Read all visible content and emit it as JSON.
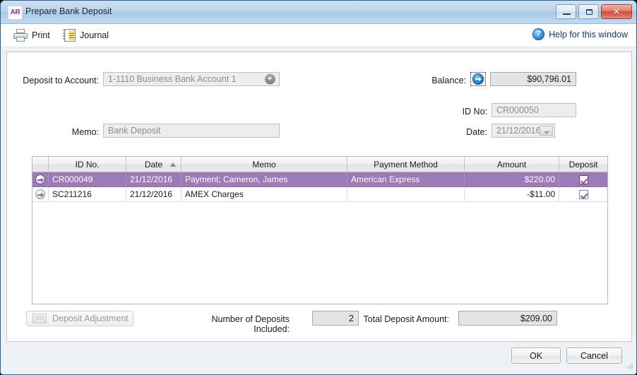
{
  "window": {
    "title": "Prepare Bank Deposit",
    "app_icon_text": "AR",
    "minimize_label": "Minimize",
    "maximize_label": "Maximize",
    "close_label": "✕"
  },
  "toolbar": {
    "print_label": "Print",
    "journal_label": "Journal",
    "help_label": "Help for this window",
    "help_icon_glyph": "?"
  },
  "form": {
    "deposit_to_account_label": "Deposit to Account:",
    "deposit_to_account_value": "1-1110 Business Bank Account 1",
    "memo_label": "Memo:",
    "memo_value": "Bank Deposit",
    "balance_label": "Balance:",
    "balance_value": "$90,796.01",
    "id_no_label": "ID No:",
    "id_no_value": "CR000050",
    "date_label": "Date:",
    "date_value": "21/12/2016"
  },
  "grid": {
    "columns": [
      {
        "key": "select",
        "label": ""
      },
      {
        "key": "id_no",
        "label": "ID No."
      },
      {
        "key": "date",
        "label": "Date",
        "sort": "asc"
      },
      {
        "key": "memo",
        "label": "Memo"
      },
      {
        "key": "payment_method",
        "label": "Payment Method"
      },
      {
        "key": "amount",
        "label": "Amount"
      },
      {
        "key": "deposit",
        "label": "Deposit"
      }
    ],
    "rows": [
      {
        "id_no": "CR000049",
        "date": "21/12/2016",
        "memo": "Payment; Cameron, James",
        "payment_method": "American Express",
        "amount": "$220.00",
        "deposit_checked": true,
        "selected": true
      },
      {
        "id_no": "SC211216",
        "date": "21/12/2016",
        "memo": "AMEX Charges",
        "payment_method": "",
        "amount": "-$11.00",
        "deposit_checked": true,
        "selected": false
      }
    ]
  },
  "footer": {
    "deposit_adjustment_label": "Deposit Adjustment",
    "number_of_deposits_label": "Number of Deposits Included:",
    "number_of_deposits_value": "2",
    "total_deposit_label": "Total Deposit Amount:",
    "total_deposit_value": "$209.00",
    "ok_label": "OK",
    "cancel_label": "Cancel"
  },
  "colors": {
    "selection_purple": "#9b7bb8",
    "titlebar_blue": "#bdd6ec",
    "window_border": "#2a6496",
    "help_link": "#17365d"
  }
}
